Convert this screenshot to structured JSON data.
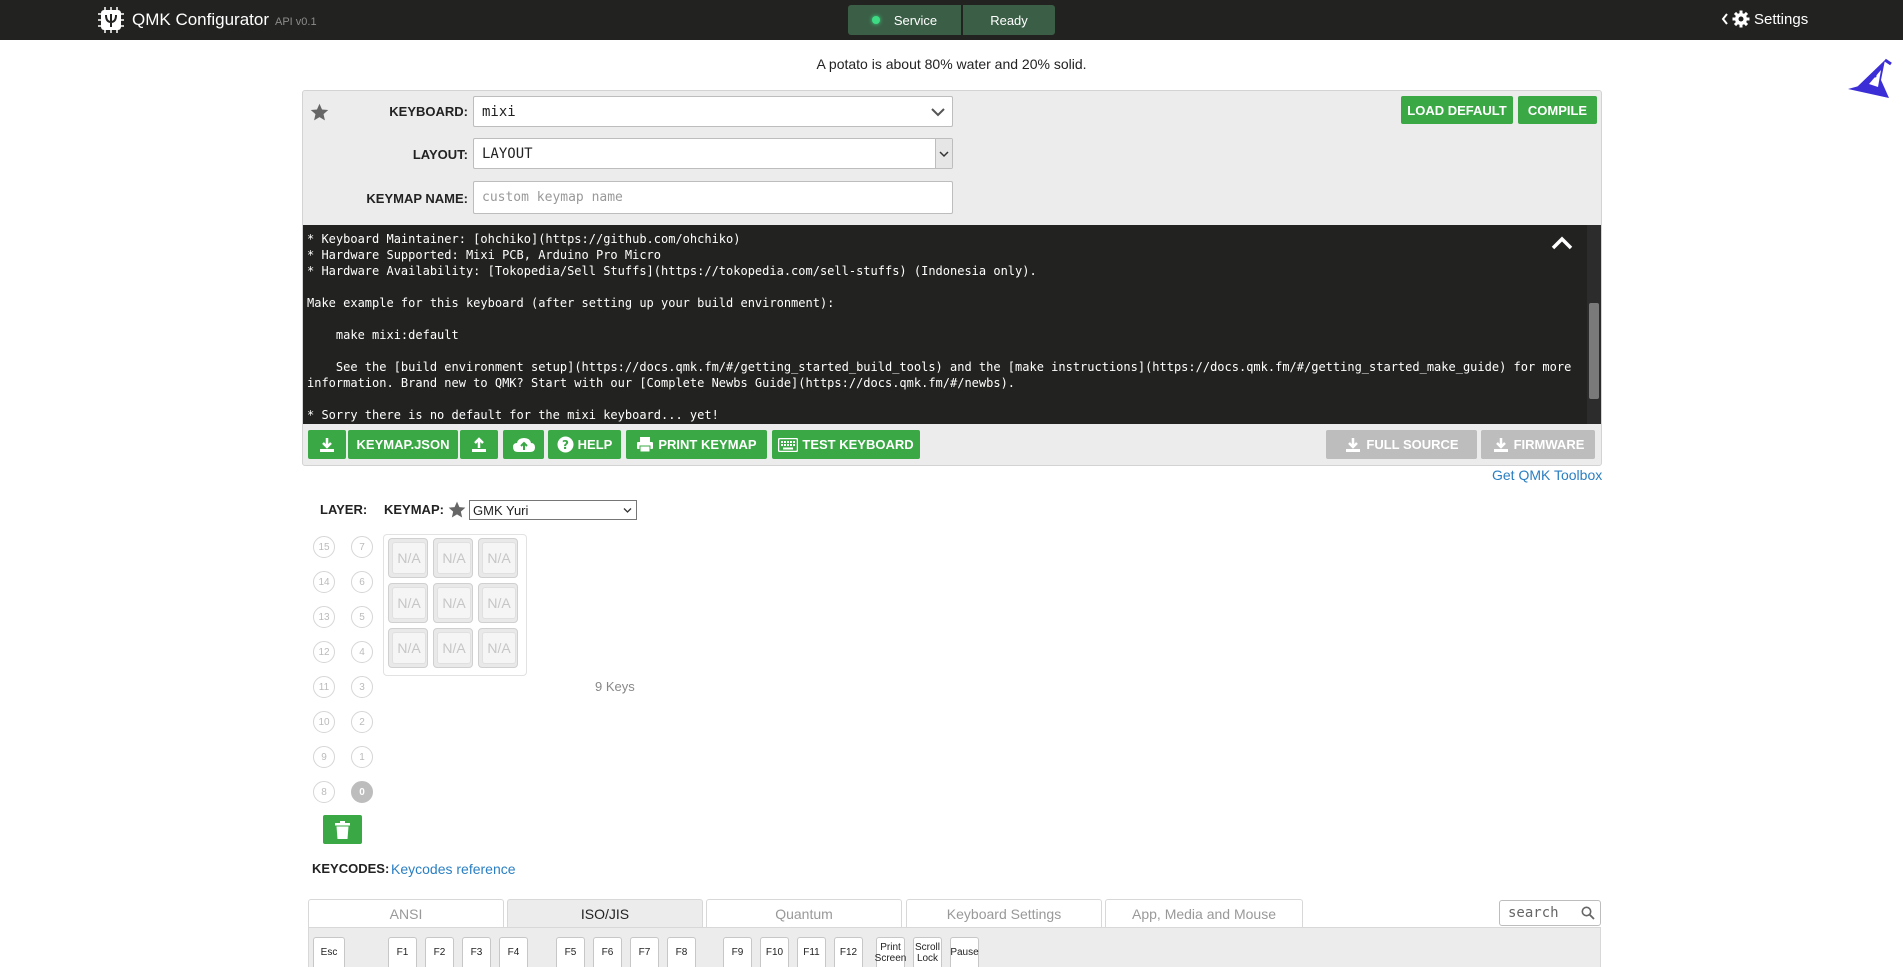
{
  "header": {
    "title": "QMK Configurator",
    "api": "API v0.1",
    "status_service": "Service",
    "status_ready": "Ready",
    "settings": "Settings"
  },
  "fact": "A potato is about 80% water and 20% solid.",
  "form": {
    "keyboard_label": "KEYBOARD:",
    "keyboard_value": "mixi",
    "layout_label": "LAYOUT:",
    "layout_value": "LAYOUT",
    "keymap_name_label": "KEYMAP NAME:",
    "keymap_name_placeholder": "custom keymap name",
    "load_default": "LOAD DEFAULT",
    "compile": "COMPILE"
  },
  "console": {
    "text": "* Keyboard Maintainer: [ohchiko](https://github.com/ohchiko)\n* Hardware Supported: Mixi PCB, Arduino Pro Micro\n* Hardware Availability: [Tokopedia/Sell Stuffs](https://tokopedia.com/sell-stuffs) (Indonesia only).\n\nMake example for this keyboard (after setting up your build environment):\n\n    make mixi:default\n\n    See the [build environment setup](https://docs.qmk.fm/#/getting_started_build_tools) and the [make instructions](https://docs.qmk.fm/#/getting_started_make_guide) for more information. Brand new to QMK? Start with our [Complete Newbs Guide](https://docs.qmk.fm/#/newbs).\n\n* Sorry there is no default for the mixi keyboard... yet!"
  },
  "toolbar": {
    "keymap_json": "KEYMAP.JSON",
    "help": "HELP",
    "print_keymap": "PRINT KEYMAP",
    "test_keyboard": "TEST KEYBOARD",
    "full_source": "FULL SOURCE",
    "firmware": "FIRMWARE",
    "toolbox_link": "Get QMK Toolbox"
  },
  "layers": {
    "label": "LAYER:",
    "left": [
      "15",
      "14",
      "13",
      "12",
      "11",
      "10",
      "9",
      "8"
    ],
    "right": [
      "7",
      "6",
      "5",
      "4",
      "3",
      "2",
      "1",
      "0"
    ],
    "active": "0"
  },
  "keymap": {
    "label": "KEYMAP:",
    "selected": "GMK Yuri",
    "keys": [
      "N/A",
      "N/A",
      "N/A",
      "N/A",
      "N/A",
      "N/A",
      "N/A",
      "N/A",
      "N/A"
    ],
    "key_count": "9 Keys"
  },
  "keycodes": {
    "label": "KEYCODES:",
    "reference": "Keycodes reference",
    "tabs": [
      "ANSI",
      "ISO/JIS",
      "Quantum",
      "Keyboard Settings",
      "App, Media and Mouse"
    ],
    "active_tab": "ISO/JIS",
    "search_placeholder": "search",
    "row": [
      "Esc",
      "F1",
      "F2",
      "F3",
      "F4",
      "F5",
      "F6",
      "F7",
      "F8",
      "F9",
      "F10",
      "F11",
      "F12",
      "Print Screen",
      "Scroll Lock",
      "Pause"
    ]
  },
  "colors": {
    "topbar": "#222220",
    "accent_green": "#3aa845",
    "status_green": "#3b5e46",
    "link_blue": "#2a7fc2",
    "disabled_gray": "#bdbdbd"
  }
}
